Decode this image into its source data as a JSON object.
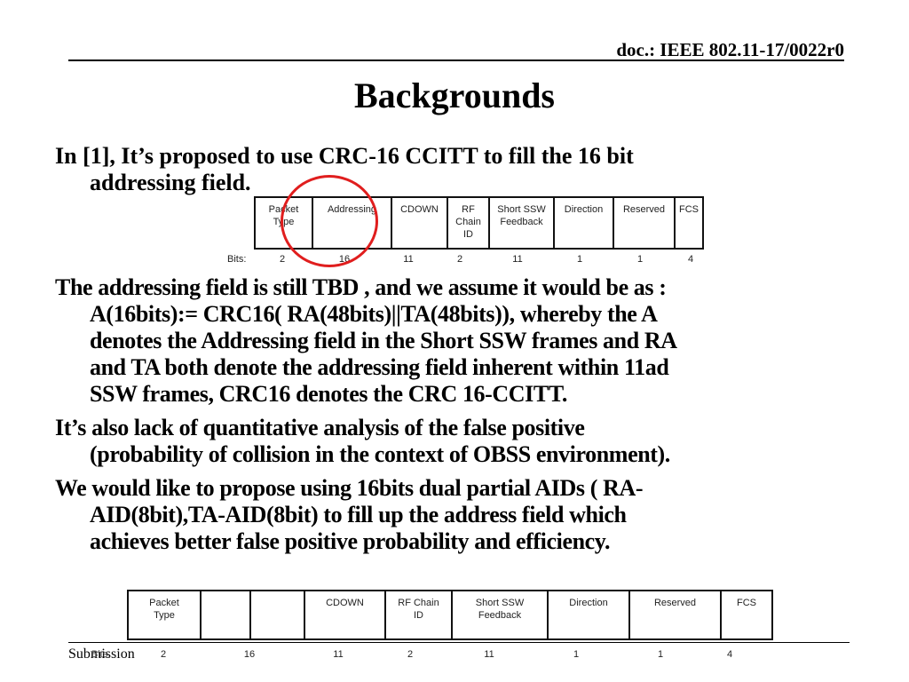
{
  "header": {
    "doc_id": "doc.: IEEE 802.11-17/0022r0"
  },
  "slide": {
    "title": "Backgrounds",
    "paragraphs": [
      {
        "lines": [
          "In [1], It’s  proposed to use CRC-16 CCITT to fill the 16 bit",
          "addressing field."
        ]
      },
      {
        "lines": [
          "The addressing field is still TBD ,  and we assume it would be as :",
          "A(16bits):= CRC16( RA(48bits)||TA(48bits)), whereby the A",
          "denotes the Addressing field in the Short SSW frames and RA",
          "and TA both denote the addressing field inherent within 11ad",
          "SSW frames, CRC16 denotes the CRC 16-CCITT."
        ]
      },
      {
        "lines": [
          "It’s also lack of quantitative analysis of the false positive",
          "(probability of collision in the context of OBSS environment)."
        ]
      },
      {
        "lines": [
          "We would like to propose using 16bits dual partial AIDs ( RA-",
          "AID(8bit),TA-AID(8bit) to fill up the address field which",
          "achieves better false positive probability and efficiency."
        ]
      }
    ]
  },
  "frame_current": {
    "bits_label": "Bits:",
    "fields": [
      {
        "name": "Packet Type",
        "line1": "Packet",
        "line2": "Type",
        "line3": "",
        "bits": "2"
      },
      {
        "name": "Addressing",
        "line1": "Addressing",
        "line2": "",
        "line3": "",
        "bits": "16"
      },
      {
        "name": "CDOWN",
        "line1": "CDOWN",
        "line2": "",
        "line3": "",
        "bits": "11"
      },
      {
        "name": "RF Chain ID",
        "line1": "RF",
        "line2": "Chain",
        "line3": "ID",
        "bits": "2"
      },
      {
        "name": "Short SSW Feedback",
        "line1": "Short SSW",
        "line2": "Feedback",
        "line3": "",
        "bits": "11"
      },
      {
        "name": "Direction",
        "line1": "Direction",
        "line2": "",
        "line3": "",
        "bits": "1"
      },
      {
        "name": "Reserved",
        "line1": "Reserved",
        "line2": "",
        "line3": "",
        "bits": "1"
      },
      {
        "name": "FCS",
        "line1": "FCS",
        "line2": "",
        "line3": "",
        "bits": "4"
      }
    ],
    "highlight": "Addressing",
    "highlight_color": "#e01e1e"
  },
  "frame_proposed": {
    "bits_label": "Bits:",
    "fields": [
      {
        "line1": "Packet",
        "line2": "Type",
        "bits": "2"
      },
      {
        "line1": "",
        "line2": "",
        "bits": ""
      },
      {
        "line1": "",
        "line2": "",
        "bits": "16"
      },
      {
        "line1": "CDOWN",
        "line2": "",
        "bits": "11"
      },
      {
        "line1": "RF Chain",
        "line2": "ID",
        "bits": "2"
      },
      {
        "line1": "Short SSW",
        "line2": "Feedback",
        "bits": "11"
      },
      {
        "line1": "Direction",
        "line2": "",
        "bits": "1"
      },
      {
        "line1": "Reserved",
        "line2": "",
        "bits": "1"
      },
      {
        "line1": "FCS",
        "line2": "",
        "bits": "4"
      }
    ]
  },
  "footer": {
    "label": "Submission"
  }
}
